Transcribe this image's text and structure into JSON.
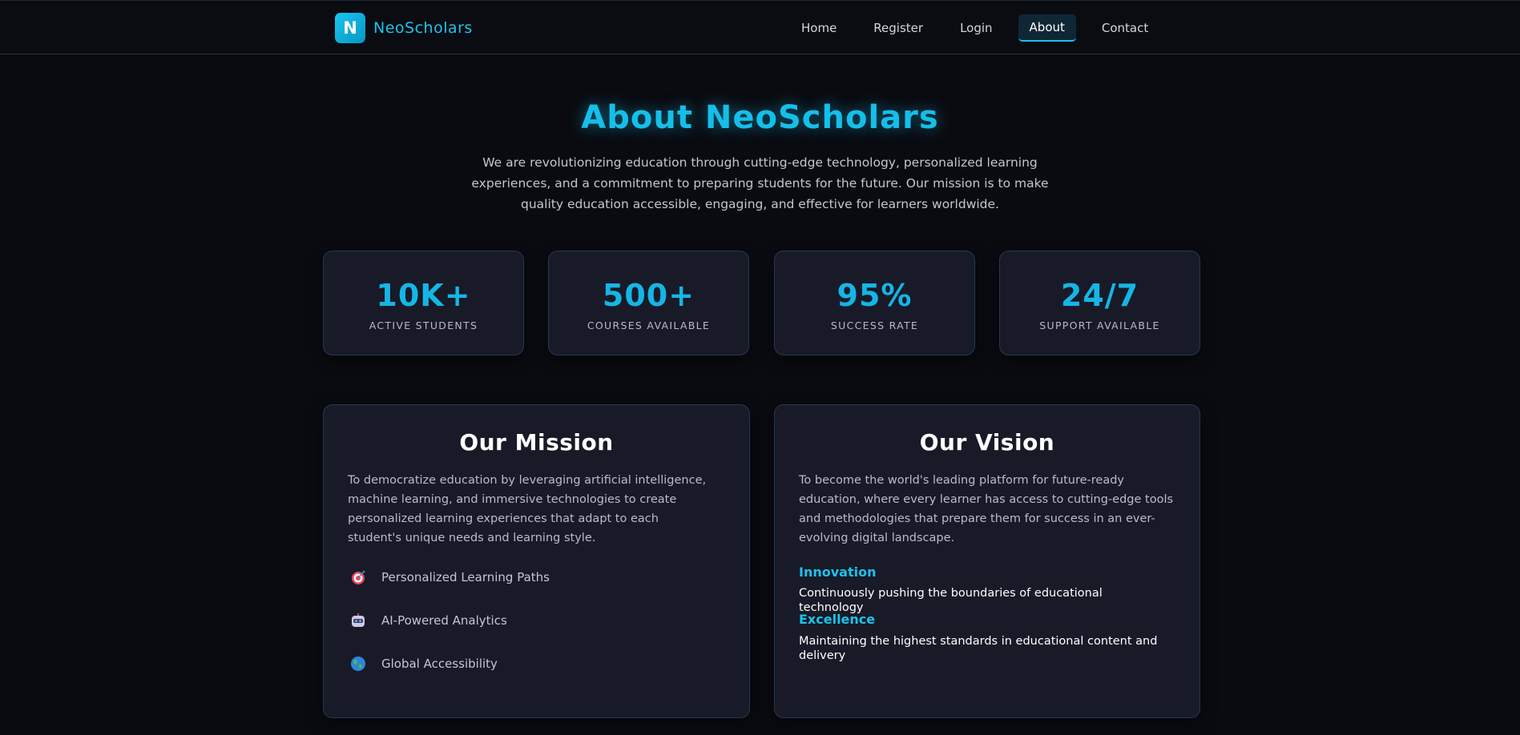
{
  "brand": {
    "logo_letter": "N",
    "name": "NeoScholars"
  },
  "nav": {
    "links": [
      "Home",
      "Register",
      "Login",
      "About",
      "Contact"
    ],
    "active": "About"
  },
  "hero": {
    "title": "About NeoScholars",
    "description": "We are revolutionizing education through cutting-edge technology, personalized learning experiences, and a commitment to preparing students for the future. Our mission is to make quality education accessible, engaging, and effective for learners worldwide."
  },
  "stats": [
    {
      "value": "10K+",
      "label": "ACTIVE STUDENTS"
    },
    {
      "value": "500+",
      "label": "COURSES AVAILABLE"
    },
    {
      "value": "95%",
      "label": "SUCCESS RATE"
    },
    {
      "value": "24/7",
      "label": "SUPPORT AVAILABLE"
    }
  ],
  "mission": {
    "title": "Our Mission",
    "text": "To democratize education by leveraging artificial intelligence, machine learning, and immersive technologies to create personalized learning experiences that adapt to each student's unique needs and learning style.",
    "features": [
      {
        "icon": "target-icon",
        "label": "Personalized Learning Paths"
      },
      {
        "icon": "robot-icon",
        "label": "AI-Powered Analytics"
      },
      {
        "icon": "globe-icon",
        "label": "Global Accessibility"
      }
    ]
  },
  "vision": {
    "title": "Our Vision",
    "text": "To become the world's leading platform for future-ready education, where every learner has access to cutting-edge tools and methodologies that prepare them for success in an ever-evolving digital landscape.",
    "values": [
      {
        "heading": "Innovation",
        "description": "Continuously pushing the boundaries of educational technology"
      },
      {
        "heading": "Excellence",
        "description": "Maintaining the highest standards in educational content and delivery"
      }
    ]
  },
  "colors": {
    "accent": "#14bfea",
    "background": "#0a0b10",
    "card": "#181a28",
    "card_border": "#223a52"
  }
}
